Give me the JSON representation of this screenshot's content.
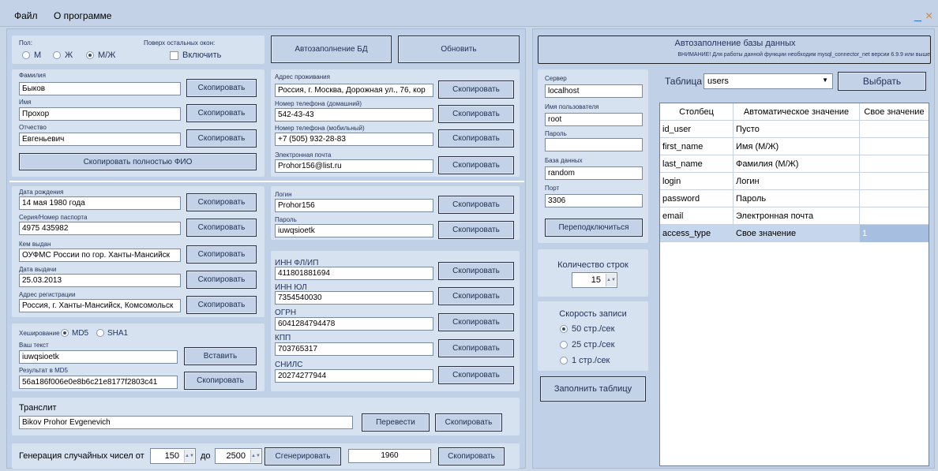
{
  "menu": {
    "file": "Файл",
    "about": "О программе"
  },
  "window": {
    "minimize": "_",
    "close": "×"
  },
  "gender": {
    "label": "Пол:",
    "options": [
      "М",
      "Ж",
      "М/Ж"
    ],
    "selected": "М/Ж"
  },
  "ontop": {
    "label": "Поверх остальных окон:",
    "checkbox": "Включить",
    "checked": false
  },
  "top_buttons": {
    "autofill": "Автозаполнение БД",
    "refresh": "Обновить"
  },
  "copy_label": "Скопировать",
  "fio": {
    "surname_label": "Фамилия",
    "surname": "Быков",
    "name_label": "Имя",
    "name": "Прохор",
    "patronymic_label": "Отчество",
    "patronymic": "Евгеньевич",
    "copy_full": "Скопировать полностью ФИО"
  },
  "address": {
    "addr_label": "Адрес проживания",
    "addr": "Россия, г. Москва, Дорожная ул., 76, кор",
    "home_phone_label": "Номер телефона (домашний)",
    "home_phone": "542-43-43",
    "mobile_label": "Номер телефона (мобильный)",
    "mobile": "+7 (505) 932-28-83",
    "email_label": "Электронная почта",
    "email": "Prohor156@list.ru"
  },
  "passport": {
    "birth_label": "Дата рождения",
    "birth": "14 мая 1980 года",
    "series_label": "Серия/Номер паспорта",
    "series": "4975 435982",
    "issued_by_label": "Кем выдан",
    "issued_by": "ОУФМС России по гор. Ханты-Мансийск",
    "issue_date_label": "Дата выдачи",
    "issue_date": "25.03.2013",
    "reg_label": "Адрес регистрации",
    "reg": "Россия, г. Ханты-Мансийск, Комсомольск"
  },
  "login": {
    "login_label": "Логин",
    "login": "Prohor156",
    "password_label": "Пароль",
    "password": "iuwqsioetk"
  },
  "org": {
    "inn_fl_label": "ИНН ФЛ/ИП",
    "inn_fl": "411801881694",
    "inn_ul_label": "ИНН ЮЛ",
    "inn_ul": "7354540030",
    "ogrn_label": "ОГРН",
    "ogrn": "6041284794478",
    "kpp_label": "КПП",
    "kpp": "703765317",
    "snils_label": "СНИЛС",
    "snils": "20274277944"
  },
  "hash": {
    "label": "Хеширование",
    "options": [
      "MD5",
      "SHA1"
    ],
    "selected": "MD5",
    "text_label": "Ваш текст",
    "text": "iuwqsioetk",
    "paste": "Вставить",
    "result_label": "Результат в MD5",
    "result": "56a186f006e0e8b6c21e8177f2803c41"
  },
  "translit": {
    "label": "Транслит",
    "value": "Bikov Prohor Evgenevich",
    "translate": "Перевести"
  },
  "random": {
    "label": "Генерация случайных чисел от",
    "from": "150",
    "to_label": "до",
    "to": "2500",
    "generate": "Сгенерировать",
    "result": "1960"
  },
  "db": {
    "title": "Автозаполнение базы данных",
    "warning": "ВНИМАНИЕ! Для работы данной функции необходим mysql_connector_net версии 6.9.9 или выше",
    "server_label": "Сервер",
    "server": "localhost",
    "user_label": "Имя пользователя",
    "user": "root",
    "pass_label": "Пароль",
    "pass": "",
    "dbname_label": "База данных",
    "dbname": "random",
    "port_label": "Порт",
    "port": "3306",
    "reconnect": "Переподключиться",
    "rows_label": "Количество строк",
    "rows": "15",
    "speed_label": "Скорость записи",
    "speed_options": [
      "50 стр./сек",
      "25 стр./сек",
      "1 стр./сек"
    ],
    "speed_selected": "50 стр./сек",
    "fill": "Заполнить таблицу",
    "table_label": "Таблица",
    "table": "users",
    "select": "Выбрать",
    "columns": [
      "Столбец",
      "Автоматическое значение",
      "Свое значение"
    ],
    "rows_data": [
      [
        "id_user",
        "Пусто",
        ""
      ],
      [
        "first_name",
        "Имя (М/Ж)",
        ""
      ],
      [
        "last_name",
        "Фамилия (М/Ж)",
        ""
      ],
      [
        "login",
        "Логин",
        ""
      ],
      [
        "password",
        "Пароль",
        ""
      ],
      [
        "email",
        "Электронная почта",
        ""
      ],
      [
        "access_type",
        "Свое значение",
        "1"
      ]
    ]
  }
}
